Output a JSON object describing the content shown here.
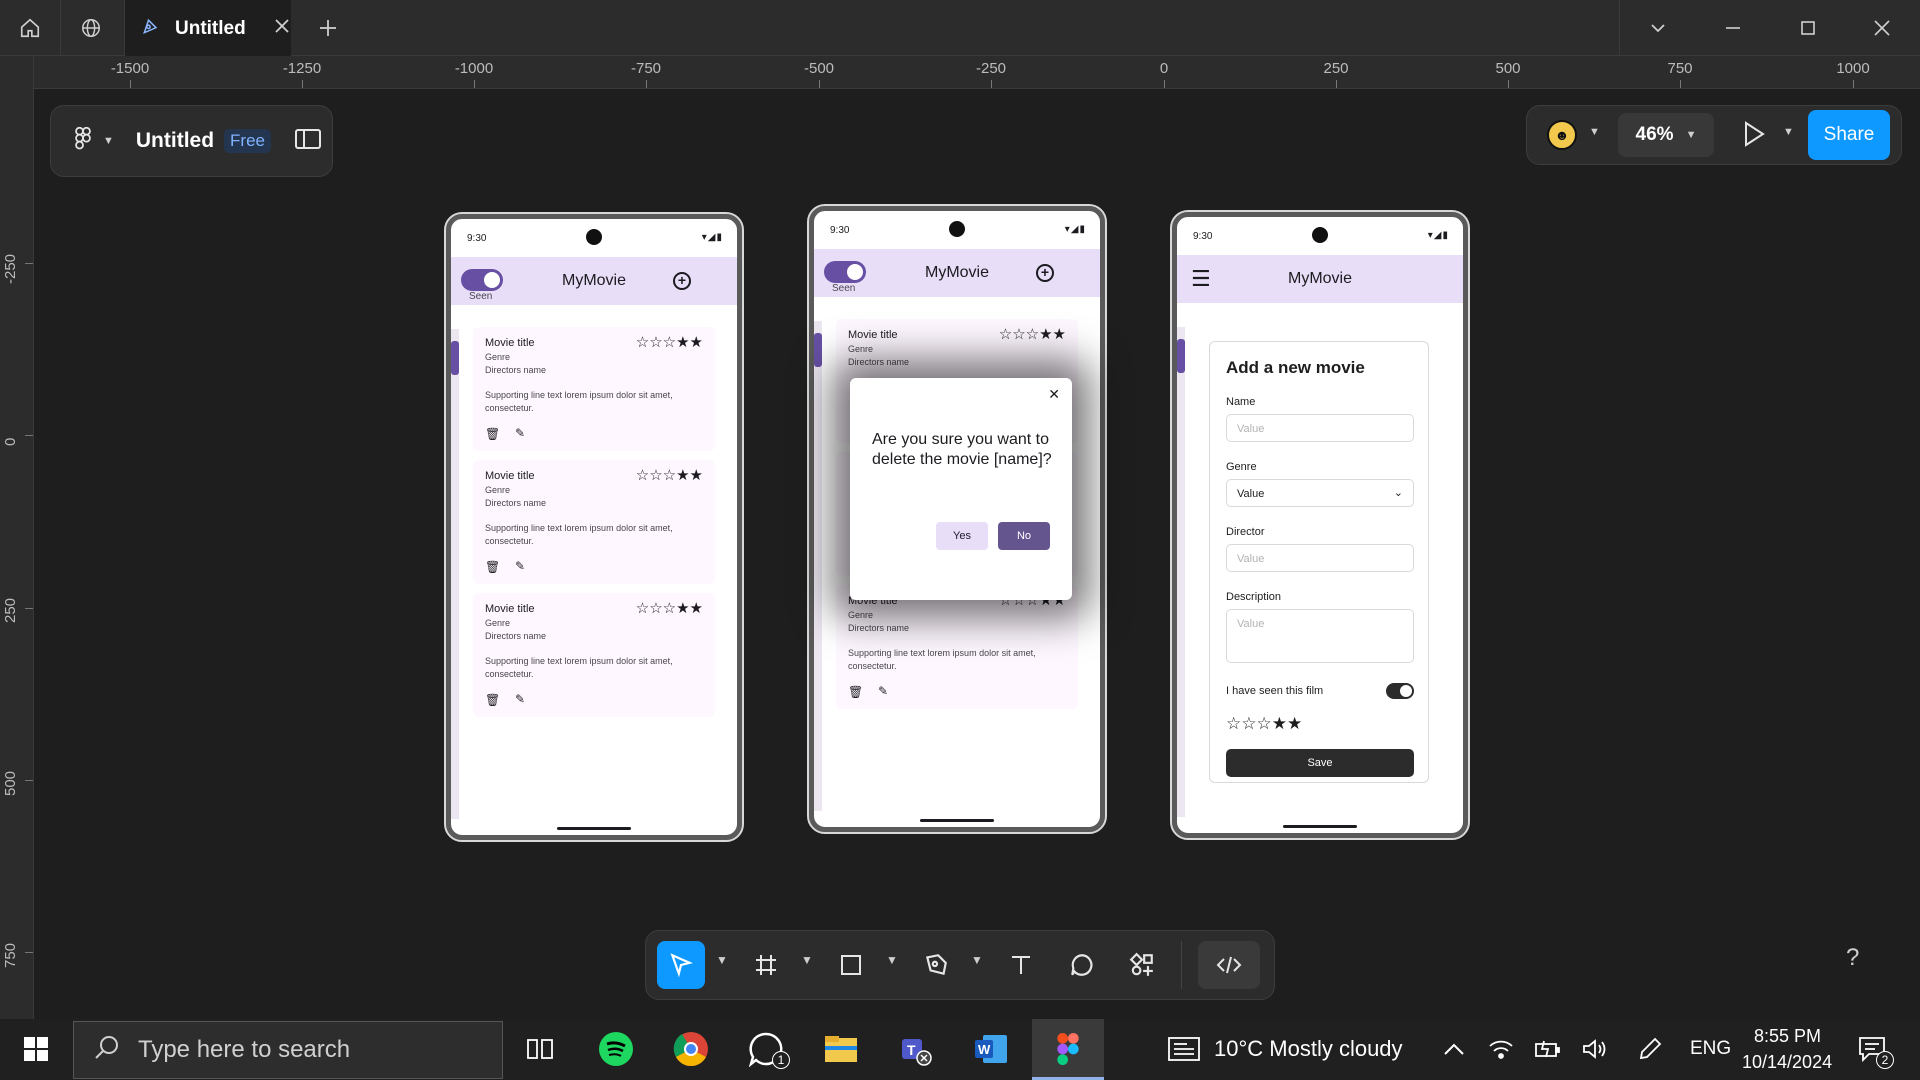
{
  "tabbar": {
    "tab_title": "Untitled"
  },
  "ruler": {
    "top_labels": [
      "-1500",
      "-1250",
      "-1000",
      "-750",
      "-500",
      "-250",
      "0",
      "250",
      "500",
      "750",
      "1000"
    ],
    "left_labels": [
      "-250",
      "0",
      "250",
      "500",
      "750"
    ]
  },
  "file_panel": {
    "file_name": "Untitled",
    "plan_badge": "Free"
  },
  "right_panel": {
    "zoom": "46%",
    "share_label": "Share"
  },
  "phone_common": {
    "time": "9:30",
    "app_title": "MyMovie",
    "seen_label": "Seen",
    "signal": "▾◢▮"
  },
  "movie_card": {
    "title": "Movie title",
    "genre": "Genre",
    "director": "Directors name",
    "supporting": "Supporting line text lorem ipsum dolor sit amet, consectetur.",
    "stars": "☆☆☆★★"
  },
  "dialog": {
    "message": "Are you sure you want to delete the movie [name]?",
    "yes_label": "Yes",
    "no_label": "No",
    "close_glyph": "✕"
  },
  "form": {
    "title": "Add a new movie",
    "name_label": "Name",
    "name_placeholder": "Value",
    "genre_label": "Genre",
    "genre_value": "Value",
    "director_label": "Director",
    "director_placeholder": "Value",
    "description_label": "Description",
    "description_placeholder": "Value",
    "seen_label": "I have seen this film",
    "stars": "☆☆☆★★",
    "save_label": "Save"
  },
  "taskbar": {
    "search_placeholder": "Type here to search",
    "weather": "10°C  Mostly cloudy",
    "language": "ENG",
    "time": "8:55 PM",
    "date": "10/14/2024",
    "whatsapp_badge": "1",
    "notification_badge": "2"
  },
  "colors": {
    "accent": "#0d99ff",
    "app_bar": "#e8def8",
    "primary": "#6750a4"
  }
}
